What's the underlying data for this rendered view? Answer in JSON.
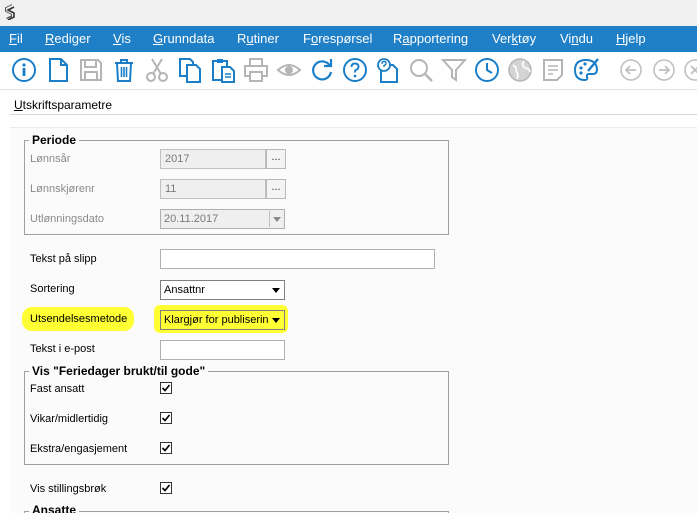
{
  "menu": {
    "items": [
      {
        "u": "F",
        "rest": "il"
      },
      {
        "u": "R",
        "rest": "ediger"
      },
      {
        "u": "V",
        "rest": "is"
      },
      {
        "u": "G",
        "rest": "runndata"
      },
      {
        "pre": "R",
        "u": "u",
        "rest": "tiner"
      },
      {
        "pre": "F",
        "u": "o",
        "rest": "respørsel"
      },
      {
        "pre": "R",
        "u": "a",
        "rest": "pportering"
      },
      {
        "pre": "Ver",
        "u": "k",
        "rest": "tøy"
      },
      {
        "pre": "Vi",
        "u": "n",
        "rest": "du"
      },
      {
        "u": "H",
        "rest": "jelp"
      }
    ]
  },
  "toolbar": {
    "icons": [
      "info-icon",
      "new-document-icon",
      "save-icon",
      "delete-icon",
      "cut-icon",
      "copy-icon",
      "paste-icon",
      "print-icon",
      "preview-icon",
      "refresh-icon",
      "help-icon",
      "document-help-icon",
      "search-icon",
      "filter-icon",
      "history-icon",
      "globe-icon",
      "notes-icon",
      "palette-icon",
      "back-icon",
      "forward-icon",
      "close-icon"
    ]
  },
  "panel": {
    "title_u": "U",
    "title_rest": "tskriftsparametre"
  },
  "periode": {
    "title": "Periode",
    "lonnsar_label": "Lønnsår",
    "lonnsar_value": "2017",
    "lonnskjorenr_label": "Lønnskjørenr",
    "lonnskjorenr_value": "11",
    "utlonningsdato_label": "Utlønningsdato",
    "utlonningsdato_value": "20.11.2017",
    "dots": "..."
  },
  "form": {
    "tekst_pa_slipp_label": "Tekst på slipp",
    "tekst_pa_slipp_value": "",
    "sortering_label": "Sortering",
    "sortering_value": "Ansattnr",
    "utsendelsesmetode_label": "Utsendelsesmetode",
    "utsendelsesmetode_value": "Klargjør for publiserin",
    "tekst_i_epost_label": "Tekst i e-post",
    "tekst_i_epost_value": ""
  },
  "feriedager": {
    "title": "Vis \"Feriedager brukt/til gode\"",
    "fast_ansatt_label": "Fast ansatt",
    "vikar_label": "Vikar/midlertidig",
    "ekstra_label": "Ekstra/engasjement"
  },
  "vis_stillingsbrok_label": "Vis stillingsbrøk",
  "ansatte_title": "Ansatte",
  "colors": {
    "menubar": "#1f7fc7",
    "icon_blue": "#1a7ec8",
    "highlight": "#ffff33"
  }
}
